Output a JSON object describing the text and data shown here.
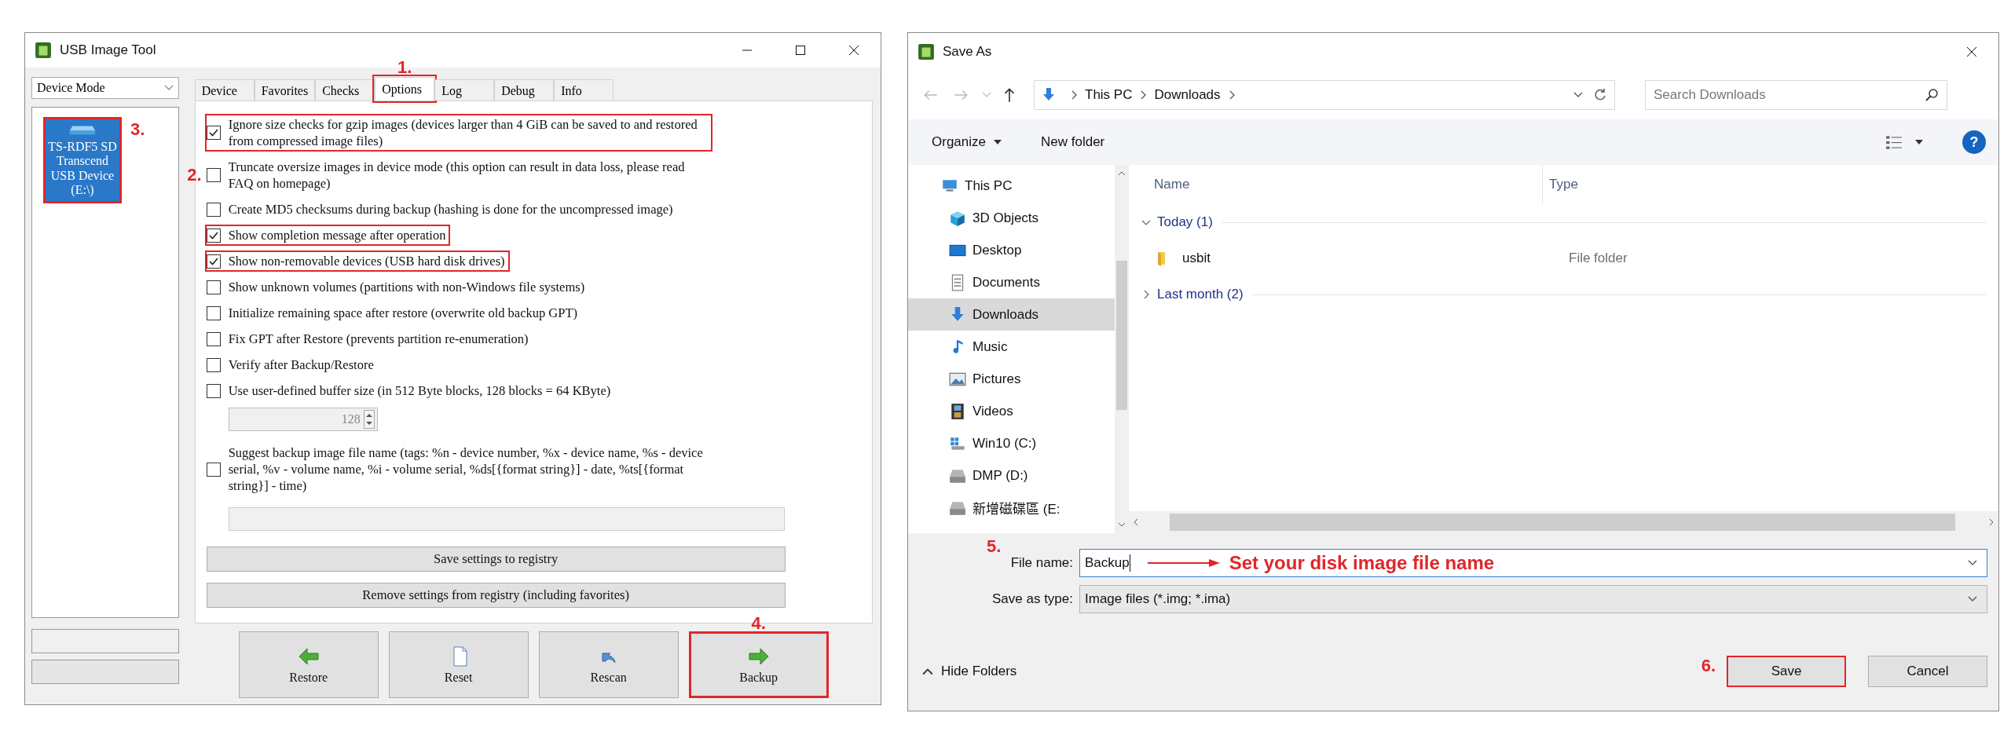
{
  "usb_image_tool": {
    "window": {
      "title": "USB Image Tool"
    },
    "mode_select": {
      "value": "Device Mode"
    },
    "devices": [
      {
        "label": "TS-RDF5 SD Transcend USB Device (E:\\)",
        "selected": true,
        "highlighted": true,
        "step": "3."
      }
    ],
    "tabs": [
      {
        "label": "Device",
        "selected": false,
        "highlighted": false
      },
      {
        "label": "Favorites",
        "selected": false,
        "highlighted": false
      },
      {
        "label": "Checks",
        "selected": false,
        "highlighted": false
      },
      {
        "label": "Options",
        "selected": true,
        "highlighted": true,
        "step": "1."
      },
      {
        "label": "Log",
        "selected": false,
        "highlighted": false
      },
      {
        "label": "Debug",
        "selected": false,
        "highlighted": false
      },
      {
        "label": "Info",
        "selected": false,
        "highlighted": false
      }
    ],
    "options": [
      {
        "label": "Ignore size checks for gzip images (devices larger than 4 GiB can be saved to and restored from compressed image files)",
        "checked": true,
        "highlighted": true
      },
      {
        "label": "Truncate oversize images in device mode (this option can result in data loss, please read FAQ on homepage)",
        "checked": false,
        "highlighted": false,
        "step": "2."
      },
      {
        "label": "Create MD5 checksums during backup (hashing is done for the uncompressed image)",
        "checked": false,
        "highlighted": false
      },
      {
        "label": "Show completion message after operation",
        "checked": true,
        "highlighted": true
      },
      {
        "label": "Show non-removable devices (USB hard disk drives)",
        "checked": true,
        "highlighted": true
      },
      {
        "label": "Show unknown volumes (partitions with non-Windows file systems)",
        "checked": false,
        "highlighted": false
      },
      {
        "label": "Initialize remaining space after restore (overwrite old backup GPT)",
        "checked": false,
        "highlighted": false
      },
      {
        "label": "Fix GPT after Restore (prevents partition re-enumeration)",
        "checked": false,
        "highlighted": false
      },
      {
        "label": "Verify after Backup/Restore",
        "checked": false,
        "highlighted": false
      },
      {
        "label": "Use user-defined buffer size (in 512 Byte blocks, 128 blocks = 64 KByte)",
        "checked": false,
        "highlighted": false
      }
    ],
    "buffer_size": {
      "value": "128",
      "disabled": true
    },
    "suggest_option": {
      "label": "Suggest backup image file name (tags: %n - device number, %x - device name, %s - device serial, %v - volume name, %i - volume serial, %ds[{format string}] - date, %ts[{format string}] - time)",
      "checked": false
    },
    "pattern_field": {
      "disabled": true
    },
    "registry_buttons": [
      "Save settings to registry",
      "Remove settings from registry (including favorites)"
    ],
    "actions": [
      {
        "kind": "restore",
        "label": "Restore",
        "highlighted": false
      },
      {
        "kind": "reset",
        "label": "Reset",
        "highlighted": false
      },
      {
        "kind": "rescan",
        "label": "Rescan",
        "highlighted": false
      },
      {
        "kind": "backup",
        "label": "Backup",
        "highlighted": true,
        "step": "4."
      }
    ]
  },
  "save_as": {
    "window": {
      "title": "Save As"
    },
    "breadcrumb": [
      "This PC",
      "Downloads"
    ],
    "search": {
      "placeholder": "Search Downloads"
    },
    "toolbar": {
      "organize": "Organize",
      "new_folder": "New folder",
      "help": "?"
    },
    "nav": [
      {
        "kind": "pc",
        "label": "This PC",
        "selected": false,
        "children": [
          {
            "kind": "cube",
            "label": "3D Objects",
            "selected": false
          },
          {
            "kind": "desktop",
            "label": "Desktop",
            "selected": false
          },
          {
            "kind": "documents",
            "label": "Documents",
            "selected": false
          },
          {
            "kind": "downloads",
            "label": "Downloads",
            "selected": true
          },
          {
            "kind": "music",
            "label": "Music",
            "selected": false
          },
          {
            "kind": "pictures",
            "label": "Pictures",
            "selected": false
          },
          {
            "kind": "videos",
            "label": "Videos",
            "selected": false
          },
          {
            "kind": "windrive",
            "label": "Win10 (C:)",
            "selected": false
          },
          {
            "kind": "drive",
            "label": "DMP (D:)",
            "selected": false
          },
          {
            "kind": "drive",
            "label": "新增磁碟區 (E:",
            "selected": false
          }
        ]
      }
    ],
    "columns": [
      "Name",
      "Type"
    ],
    "groups": [
      {
        "label": "Today (1)",
        "expanded": true,
        "children": [
          {
            "name": "usbit",
            "type": "File folder"
          }
        ]
      },
      {
        "label": "Last month (2)",
        "expanded": false
      }
    ],
    "file_name": {
      "label": "File name:",
      "value": "Backup",
      "step": "5.",
      "annotation": "Set your disk image file name"
    },
    "save_type": {
      "label": "Save as type:",
      "value": "Image files (*.img; *.ima)"
    },
    "hide_folders": "Hide Folders",
    "buttons": [
      {
        "label": "Save",
        "highlighted": true,
        "step": "6."
      },
      {
        "label": "Cancel",
        "highlighted": false
      }
    ]
  }
}
